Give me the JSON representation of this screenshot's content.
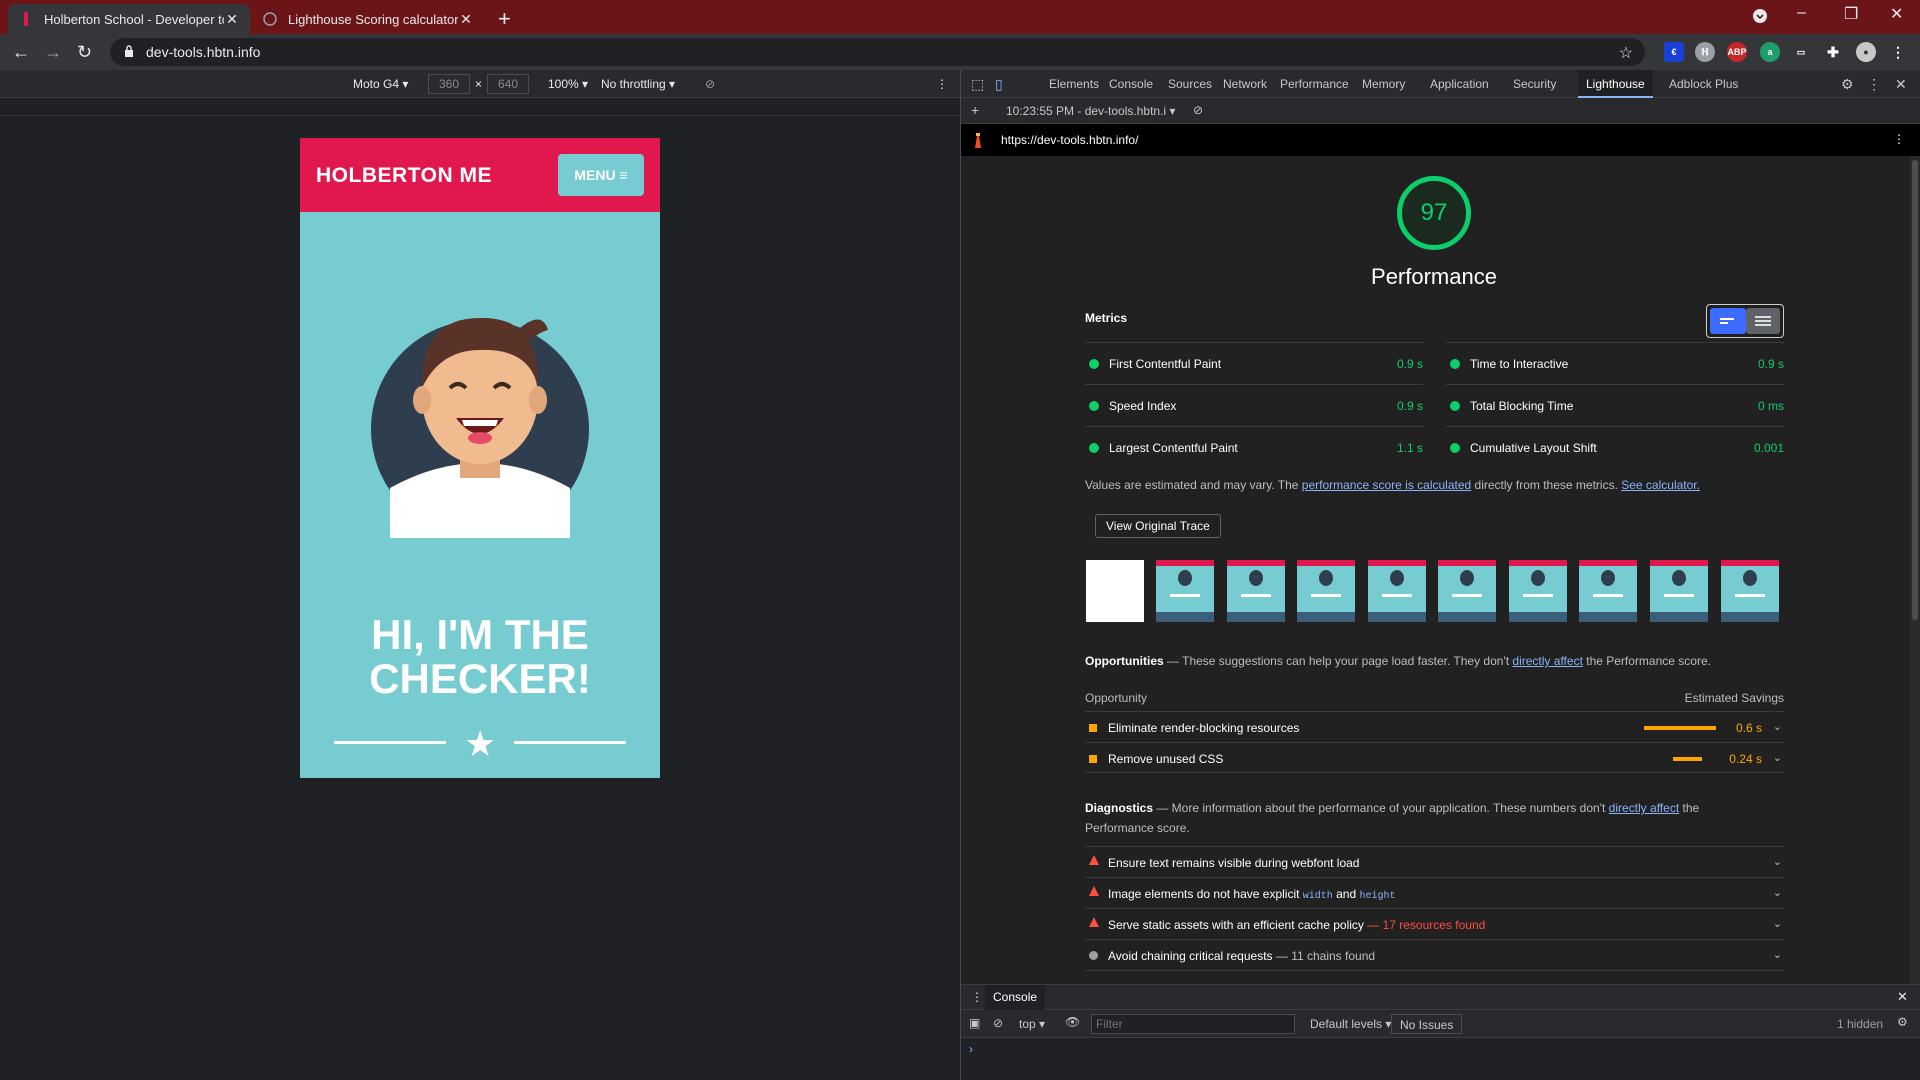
{
  "browser": {
    "tabs": [
      {
        "title": "Holberton School - Developer to",
        "active": true
      },
      {
        "title": "Lighthouse Scoring calculator",
        "active": false
      }
    ],
    "address": "dev-tools.hbtn.info"
  },
  "device_toolbar": {
    "device": "Moto G4",
    "width": "360",
    "height": "640",
    "times": "×",
    "zoom": "100%",
    "throttling": "No throttling"
  },
  "site": {
    "brand": "HOLBERTON ME",
    "menu_label": "MENU ≡",
    "hero_line1": "HI, I'M THE",
    "hero_line2": "CHECKER!"
  },
  "devtools": {
    "tabs": [
      "Elements",
      "Console",
      "Sources",
      "Network",
      "Performance",
      "Memory",
      "Application",
      "Security",
      "Lighthouse",
      "Adblock Plus"
    ],
    "active_tab": "Lighthouse",
    "report_selector": "10:23:55 PM - dev-tools.hbtn.i",
    "report_url": "https://dev-tools.hbtn.info/"
  },
  "report": {
    "score": "97",
    "category": "Performance",
    "metrics_title": "Metrics",
    "metrics": [
      {
        "name": "First Contentful Paint",
        "value": "0.9 s"
      },
      {
        "name": "Time to Interactive",
        "value": "0.9 s"
      },
      {
        "name": "Speed Index",
        "value": "0.9 s"
      },
      {
        "name": "Total Blocking Time",
        "value": "0 ms"
      },
      {
        "name": "Largest Contentful Paint",
        "value": "1.1 s"
      },
      {
        "name": "Cumulative Layout Shift",
        "value": "0.001"
      }
    ],
    "note_prefix": "Values are estimated and may vary. The ",
    "note_link1": "performance score is calculated",
    "note_middle": " directly from these metrics. ",
    "note_link2": "See calculator.",
    "trace_button": "View Original Trace",
    "opportunities": {
      "title": "Opportunities",
      "desc_prefix": " — These suggestions can help your page load faster. They don't ",
      "desc_link": "directly affect",
      "desc_suffix": " the Performance score.",
      "col1": "Opportunity",
      "col2": "Estimated Savings",
      "items": [
        {
          "label": "Eliminate render-blocking resources",
          "savings": "0.6 s",
          "bar_fraction": 1.0
        },
        {
          "label": "Remove unused CSS",
          "savings": "0.24 s",
          "bar_fraction": 0.4
        }
      ]
    },
    "diagnostics": {
      "title": "Diagnostics",
      "desc_prefix": " — More information about the performance of your application. These numbers don't ",
      "desc_link": "directly affect",
      "desc_suffix": " the",
      "desc_line2": "Performance score.",
      "items": [
        {
          "label": "Ensure text remains visible during webfont load",
          "extra": ""
        },
        {
          "label_a": "Image elements do not have explicit ",
          "code1": "width",
          "label_b": " and ",
          "code2": "height"
        },
        {
          "label": "Serve static assets with an efficient cache policy",
          "extra": " — 17 resources found"
        },
        {
          "label": "Avoid chaining critical requests",
          "extra": " — 11 chains found"
        }
      ]
    }
  },
  "console": {
    "tab": "Console",
    "context": "top",
    "filter_placeholder": "Filter",
    "levels": "Default levels",
    "issues": "No Issues",
    "hidden": "1 hidden"
  },
  "colors": {
    "pass": "#0cce6b",
    "average": "#ffa400",
    "fail": "#ff4e42",
    "brand_red": "#e0184d",
    "brand_teal": "#76ccd1"
  }
}
